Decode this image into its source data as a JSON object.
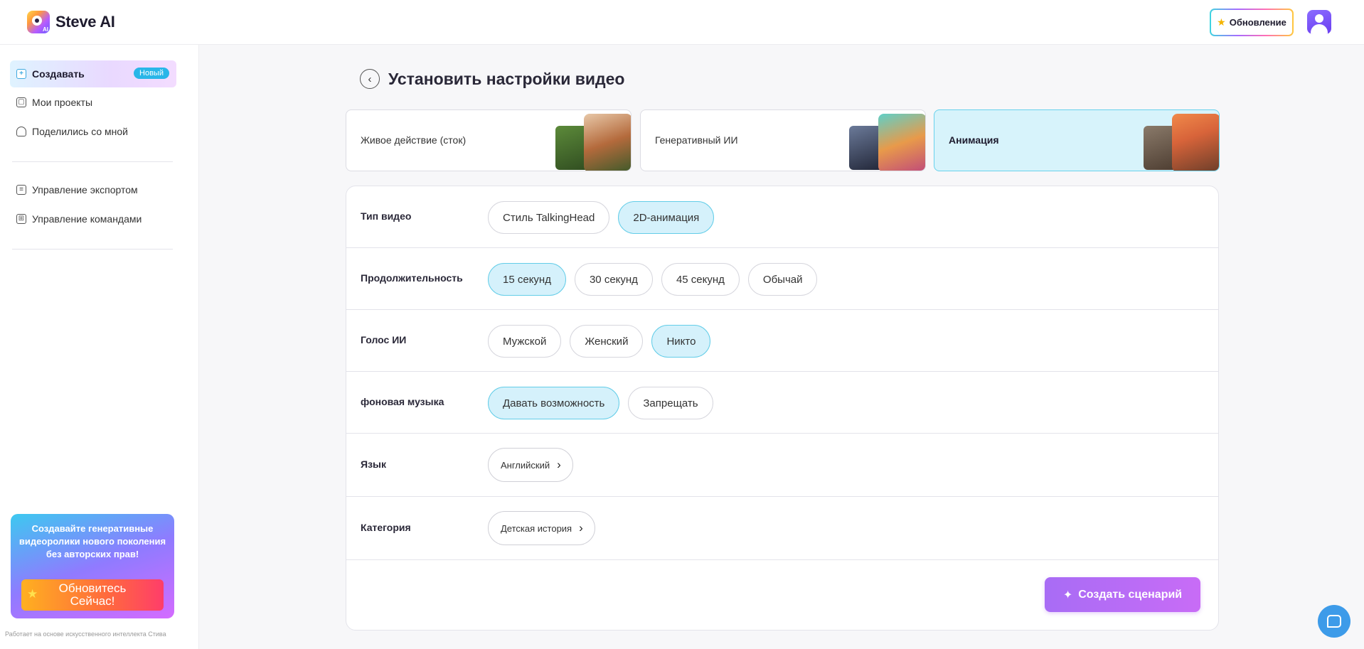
{
  "app": {
    "logo_text": "Steve AI",
    "logo_badge": "AI",
    "upgrade_label": "Обновление"
  },
  "sidebar": {
    "items": [
      {
        "label": "Создавать",
        "badge": "Новый",
        "icon": "plus-square-icon"
      },
      {
        "label": "Мои проекты",
        "icon": "projects-icon"
      },
      {
        "label": "Поделились со мной",
        "icon": "shared-user-icon"
      },
      {
        "label": "Управление экспортом",
        "icon": "export-icon"
      },
      {
        "label": "Управление командами",
        "icon": "team-icon"
      }
    ],
    "promo": {
      "text": "Создавайте генеративные видеоролики нового поколения без авторских прав!",
      "button_line1": "Обновитесь",
      "button_line2": "Сейчас!"
    },
    "powered_by": "Работает на основе искусственного интеллекта Стива"
  },
  "main": {
    "title": "Установить настройки видео",
    "video_types": [
      {
        "label": "Живое действие (сток)",
        "selected": false
      },
      {
        "label": "Генеративный ИИ",
        "selected": false
      },
      {
        "label": "Анимация",
        "selected": true
      }
    ],
    "rows": {
      "video_type": {
        "label": "Тип видео",
        "options": [
          "Стиль TalkingHead",
          "2D-анимация"
        ],
        "selected": "2D-анимация"
      },
      "duration": {
        "label": "Продолжительность",
        "options": [
          "15 секунд",
          "30 секунд",
          "45 секунд",
          "Обычай"
        ],
        "selected": "15 секунд"
      },
      "voice": {
        "label": "Голос ИИ",
        "options": [
          "Мужской",
          "Женский",
          "Никто"
        ],
        "selected": "Никто"
      },
      "music": {
        "label": "фоновая музыка",
        "options": [
          "Давать возможность",
          "Запрещать"
        ],
        "selected": "Давать возможность"
      },
      "language": {
        "label": "Язык",
        "value": "Английский"
      },
      "category": {
        "label": "Категория",
        "value": "Детская история"
      }
    },
    "create_button": "Создать сценарий"
  },
  "colors": {
    "accent_cyan": "#d5f1fb",
    "accent_purple": "#a86cf5",
    "badge_blue": "#29b6e8"
  }
}
